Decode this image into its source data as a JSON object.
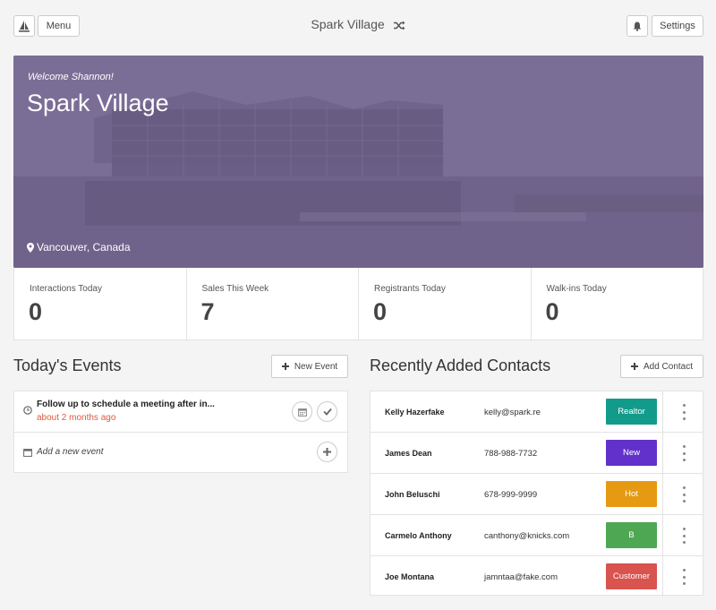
{
  "topbar": {
    "menu_label": "Menu",
    "title": "Spark Village",
    "settings_label": "Settings"
  },
  "hero": {
    "welcome": "Welcome Shannon!",
    "title": "Spark Village",
    "location": "Vancouver, Canada",
    "overlay_color": "#7b6e96"
  },
  "stats": [
    {
      "label": "Interactions Today",
      "value": "0"
    },
    {
      "label": "Sales This Week",
      "value": "7"
    },
    {
      "label": "Registrants Today",
      "value": "0"
    },
    {
      "label": "Walk-ins Today",
      "value": "0"
    }
  ],
  "events": {
    "heading": "Today's Events",
    "new_button": "New Event",
    "items": [
      {
        "title": "Follow up to schedule a meeting after in...",
        "time": "about 2 months ago"
      }
    ],
    "add_label": "Add a new event"
  },
  "contacts": {
    "heading": "Recently Added Contacts",
    "add_button": "Add Contact",
    "rows": [
      {
        "name": "Kelly Hazerfake",
        "info": "kelly@spark.re",
        "badge": "Realtor",
        "badge_color": "#129b8b"
      },
      {
        "name": "James Dean",
        "info": "788-988-7732",
        "badge": "New",
        "badge_color": "#6231cb"
      },
      {
        "name": "John Beluschi",
        "info": "678-999-9999",
        "badge": "Hot",
        "badge_color": "#e69a12"
      },
      {
        "name": "Carmelo Anthony",
        "info": "canthony@knicks.com",
        "badge": "B",
        "badge_color": "#4ea752"
      },
      {
        "name": "Joe Montana",
        "info": "jamntaa@fake.com",
        "badge": "Customer",
        "badge_color": "#d9534f"
      }
    ]
  },
  "icons": {
    "logo": "sail-logo-icon",
    "shuffle": "shuffle-icon",
    "bell": "bell-icon",
    "location": "map-marker-icon",
    "plus": "plus-icon",
    "clock": "clock-icon",
    "calendar": "calendar-icon",
    "check": "check-icon",
    "more": "vertical-dots-icon"
  }
}
